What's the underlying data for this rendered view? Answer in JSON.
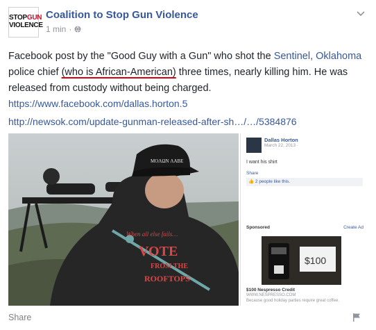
{
  "post": {
    "page_name": "Coalition to Stop Gun Violence",
    "avatar_line1": "STOP",
    "avatar_line1_red": "GUN",
    "avatar_line2": "VIOLENCE",
    "time": "1 min",
    "dot": "·",
    "text_part1": "Facebook post by the \"Good Guy with a Gun\" who shot the ",
    "text_link": "Sentinel, Oklahoma",
    "text_part2": " police chief ",
    "text_underlined": "(who is African-American)",
    "text_part3": " three times, nearly killing him. He was released from custody without being charged.",
    "url1": "https://www.facebook.com/dallas.horton.5",
    "url2": "http://newsok.com/update-gunman-released-after-sh…/…/5384876",
    "share_label": "Share"
  },
  "photo": {
    "hat_text": "MOΛΩN ΛΑΒΕ",
    "shirt_line1": "When all else fails…",
    "shirt_line2": "VOTE",
    "shirt_line3": "FROM THE",
    "shirt_line4": "ROOFTOPS"
  },
  "embedded": {
    "name": "Dallas Horton",
    "date": "March 22, 2013 · ",
    "text": "I want his shirt",
    "share": "Share",
    "likes": "2 people like this.",
    "sponsored": "Sponsored",
    "create_ad": "Create Ad",
    "ad_price": "$100",
    "ad_title": "$100 Nespresso Credit",
    "ad_url": "WWW.NESPRESSO.COM",
    "ad_text": "Because good holiday parties require great coffee."
  },
  "colors": {
    "link": "#365899",
    "text": "#1d2129",
    "meta": "#90949c",
    "underline": "#d6000f"
  }
}
